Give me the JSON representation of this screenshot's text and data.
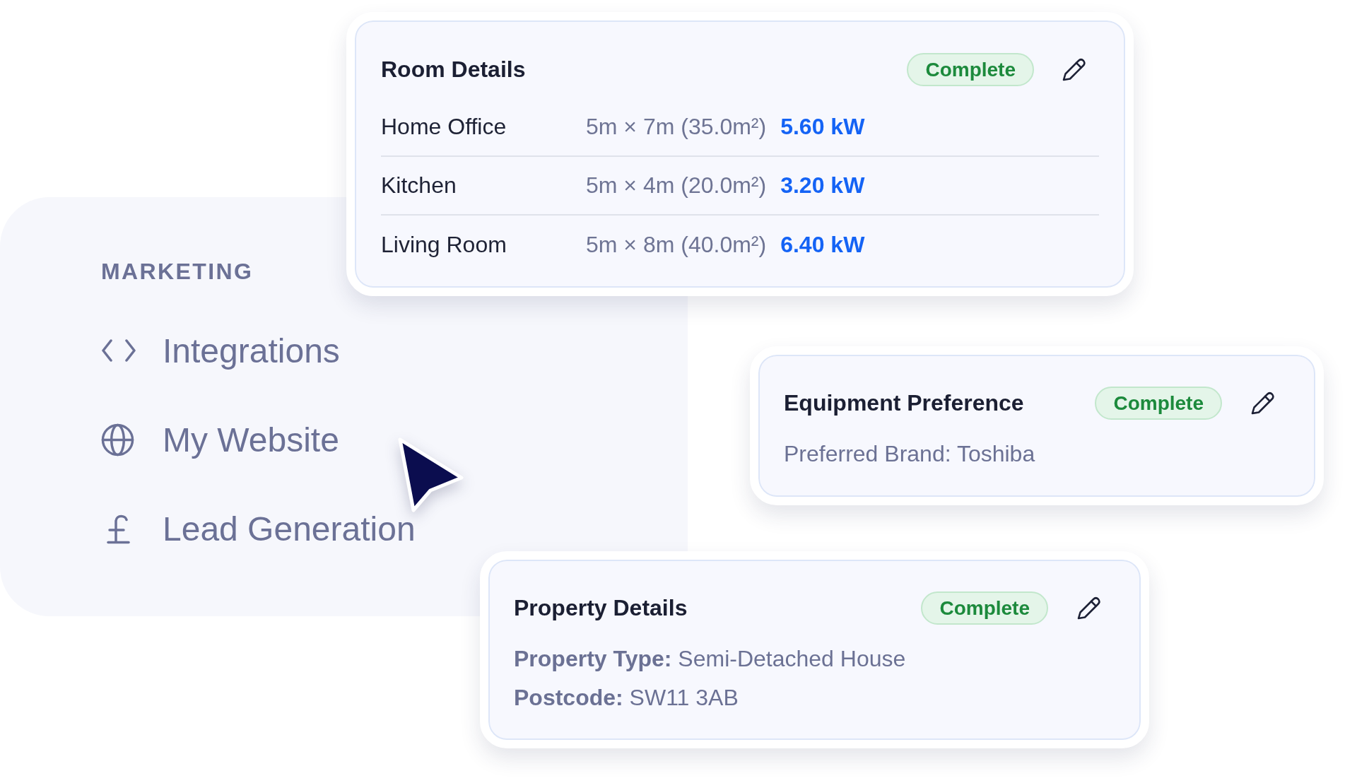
{
  "room_details": {
    "title": "Room Details",
    "status": "Complete",
    "rows": [
      {
        "name": "Home Office",
        "dimensions": "5m × 7m (35.0m²)",
        "output": "5.60 kW"
      },
      {
        "name": "Kitchen",
        "dimensions": "5m × 4m (20.0m²)",
        "output": "3.20 kW"
      },
      {
        "name": "Living Room",
        "dimensions": "5m × 8m (40.0m²)",
        "output": "6.40 kW"
      }
    ]
  },
  "sidebar": {
    "section_title": "MARKETING",
    "items": [
      {
        "label": "Integrations"
      },
      {
        "label": "My Website"
      },
      {
        "label": "Lead Generation"
      }
    ]
  },
  "equipment_preference": {
    "title": "Equipment Preference",
    "status": "Complete",
    "lines": [
      "Preferred Brand: Toshiba"
    ]
  },
  "property_details": {
    "title": "Property Details",
    "status": "Complete",
    "lines": [
      "**Property Type:** Semi-Detached House",
      "**Postcode:** SW11 3AB"
    ]
  }
}
